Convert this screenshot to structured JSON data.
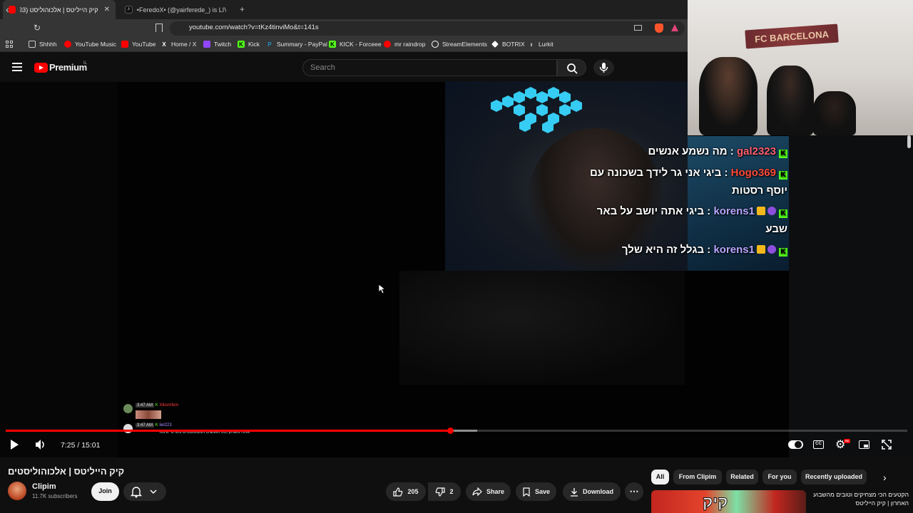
{
  "browser": {
    "tabs": [
      {
        "title": "קיק הייליטס | אלכוהוליסט (2623)",
        "active": true,
        "favicon_color": "#ff0000"
      },
      {
        "title": "•FeredoX• (@yairferede_) is LIVE - Ti",
        "active": false,
        "favicon_color": "#ffffff"
      }
    ],
    "new_tab": "+",
    "url": "youtube.com/watch?v=tKz4tinviMo&t=141s",
    "bookmarks": [
      {
        "label": "Shhhh",
        "icon": "folder-icon",
        "color": "#cfcfcf"
      },
      {
        "label": "YouTube Music",
        "icon": "youtube-music-icon",
        "color": "#ff0000"
      },
      {
        "label": "YouTube",
        "icon": "youtube-icon",
        "color": "#ff0000"
      },
      {
        "label": "Home / X",
        "icon": "x-icon",
        "color": "#ffffff"
      },
      {
        "label": "Twitch",
        "icon": "twitch-icon",
        "color": "#9146ff"
      },
      {
        "label": "Kick",
        "icon": "kick-icon",
        "color": "#53fc18"
      },
      {
        "label": "Summary - PayPal",
        "icon": "paypal-icon",
        "color": "#2790c3"
      },
      {
        "label": "KICK - Forceee",
        "icon": "kick-icon",
        "color": "#53fc18"
      },
      {
        "label": "mr raindrop",
        "icon": "youtube-icon",
        "color": "#ff0000"
      },
      {
        "label": "StreamElements",
        "icon": "streamelements-icon",
        "color": "#ffffff"
      },
      {
        "label": "BOTRIX",
        "icon": "botrix-icon",
        "color": "#ffffff"
      },
      {
        "label": "Lurkit",
        "icon": "lurkit-icon",
        "color": "#ffffff"
      }
    ]
  },
  "youtube": {
    "logo_text": "Premium",
    "logo_region": "IL",
    "search_placeholder": "Search"
  },
  "overlay_chat": [
    {
      "user": "gal2323",
      "user_color": "#ff5f6f",
      "badges": [
        "kick"
      ],
      "message": "מה נשמע אנשים",
      "continuation": ""
    },
    {
      "user": "Hogo369",
      "user_color": "#ff4a3a",
      "badges": [
        "kick"
      ],
      "message": "ביגי אני גר לידך בשכונה עם",
      "continuation": "יוסף רסטות"
    },
    {
      "user": "korens1",
      "user_color": "#b7a6ff",
      "badges": [
        "kick",
        "sub",
        "crown"
      ],
      "message": "ביגי אתה יושב על באר",
      "continuation": "שבע"
    },
    {
      "user": "korens1",
      "user_color": "#b7a6ff",
      "badges": [
        "kick",
        "sub",
        "crown"
      ],
      "message": "בגלל זה היא שלך",
      "continuation": ""
    }
  ],
  "irl_stream": {
    "banner_text": "FC BARCELONA"
  },
  "mini_chat": [
    {
      "time": "3:47 AM",
      "user": "Xtkomfem",
      "user_color": "#ff3b3b",
      "message": ""
    },
    {
      "time": "3:47 AM",
      "user": "liel223",
      "user_color": "#a58bff",
      "message": "אתה משחק כמו האנשים המטומטמים בסרטי אימה"
    }
  ],
  "player": {
    "current_time": "7:25",
    "duration": "15:01",
    "time_display": "7:25 / 15:01",
    "progress_fraction": 0.493,
    "settings_badge": "HD"
  },
  "video": {
    "title": "קיק הייליטס | אלכוהוליסטים",
    "channel": "Clipim",
    "subscribers": "11.7K subscribers",
    "join_label": "Join",
    "likes": "205",
    "dislikes": "2",
    "share_label": "Share",
    "save_label": "Save",
    "download_label": "Download"
  },
  "related": {
    "chips": [
      "All",
      "From Clipim",
      "Related",
      "For you",
      "Recently uploaded"
    ],
    "first_title": "הקטעים הכי מצחיקים וטובים מהשבוע האחרון | קיק הייליטס",
    "thumb_text": "קיק"
  }
}
